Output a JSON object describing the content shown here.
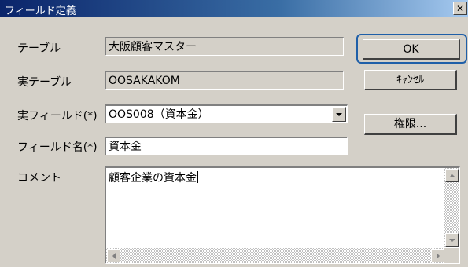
{
  "dialog": {
    "title": "フィールド定義",
    "close_glyph": "✕"
  },
  "fields": {
    "table_label": "テーブル",
    "table_value": "大阪顧客マスター",
    "real_table_label": "実テーブル",
    "real_table_value": "OOSAKAKOM",
    "real_field_label": "実フィールド(*)",
    "real_field_value": "OOS008（資本金）",
    "field_name_label": "フィールド名(*)",
    "field_name_value": "資本金",
    "comment_label": "コメント",
    "comment_value": "顧客企業の資本金"
  },
  "buttons": {
    "ok": "OK",
    "cancel": "ｷｬﾝｾﾙ",
    "permission": "権限..."
  },
  "colors": {
    "title_bar": "#0a246a",
    "dialog_bg": "#d4d0c8",
    "focus_ring": "#1f5fa8"
  }
}
